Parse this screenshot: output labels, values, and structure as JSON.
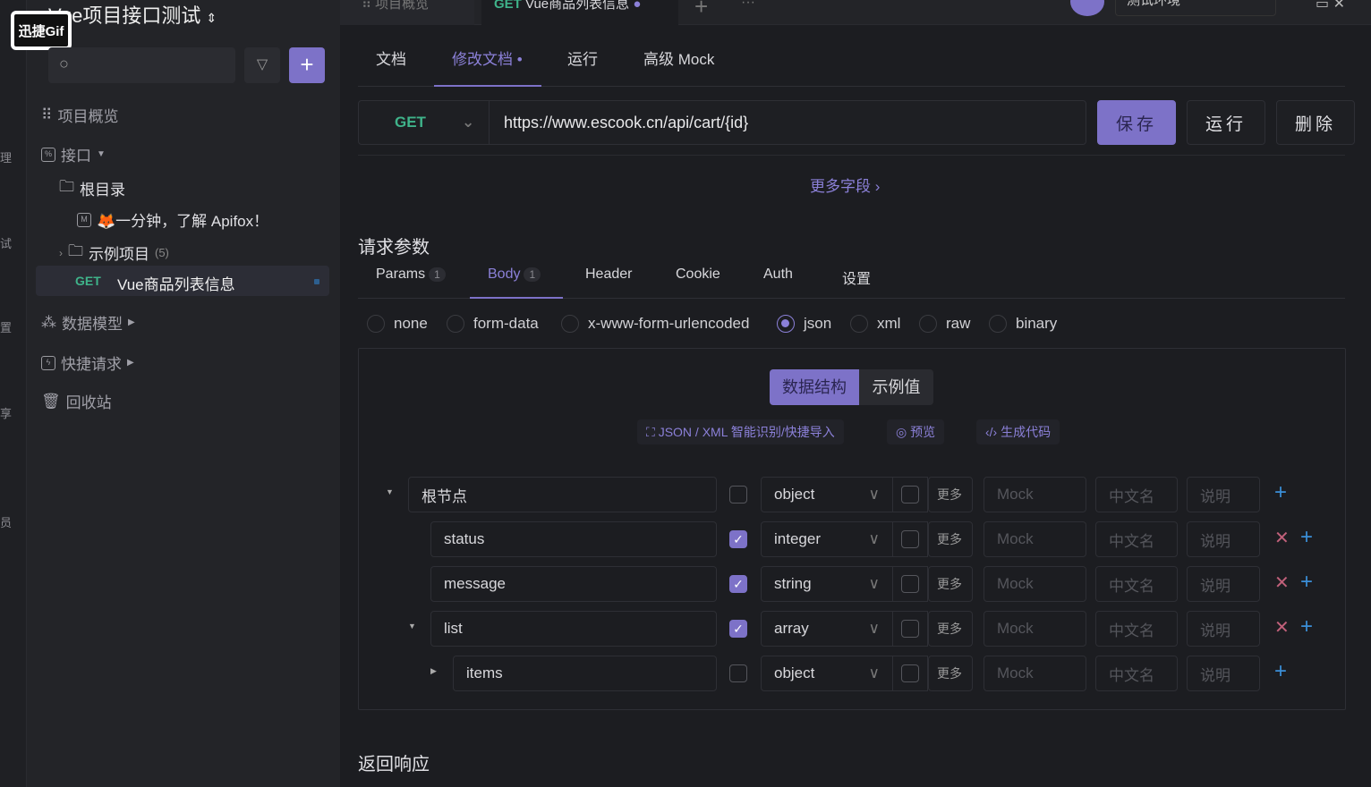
{
  "watermark": "迅捷Gif",
  "project": {
    "title": "Vue项目接口测试",
    "switch_icon": "⌃⌄"
  },
  "rail": [
    "理",
    "试",
    "置",
    "享",
    "员"
  ],
  "top_tabs": [
    {
      "label": "项目概览"
    },
    {
      "method": "GET",
      "label": "Vue商品列表信息"
    }
  ],
  "environment": "测试环境",
  "sidebar": {
    "items": [
      {
        "label": "项目概览"
      },
      {
        "label": "接口"
      },
      {
        "label": "根目录"
      },
      {
        "label": "🦊一分钟，了解 Apifox！"
      },
      {
        "label": "示例项目",
        "count": "(5)"
      },
      {
        "method": "GET",
        "label": "Vue商品列表信息"
      },
      {
        "label": "数据模型"
      },
      {
        "label": "快捷请求"
      },
      {
        "label": "回收站"
      }
    ]
  },
  "doc_tabs": [
    "文档",
    "修改文档",
    "运行",
    "高级 Mock"
  ],
  "request": {
    "method": "GET",
    "url": "https://www.escook.cn/api/cart/{id}",
    "save": "保存",
    "run": "运行",
    "delete": "删除",
    "more_fields": "更多字段"
  },
  "params_title": "请求参数",
  "param_tabs": [
    {
      "label": "Params",
      "count": "1"
    },
    {
      "label": "Body",
      "count": "1"
    },
    {
      "label": "Header"
    },
    {
      "label": "Cookie"
    },
    {
      "label": "Auth"
    },
    {
      "label": "设置"
    }
  ],
  "body_types": [
    "none",
    "form-data",
    "x-www-form-urlencoded",
    "json",
    "xml",
    "raw",
    "binary"
  ],
  "body_selected": "json",
  "mode": {
    "structure": "数据结构",
    "example": "示例值"
  },
  "tools": {
    "import": "JSON / XML 智能识别/快捷导入",
    "preview": "预览",
    "code": "生成代码"
  },
  "schema_placeholders": {
    "more": "更多",
    "mock": "Mock",
    "cn": "中文名",
    "desc": "说明"
  },
  "schema": [
    {
      "name": "根节点",
      "type": "object",
      "required": false
    },
    {
      "name": "status",
      "type": "integer",
      "required": true
    },
    {
      "name": "message",
      "type": "string",
      "required": true
    },
    {
      "name": "list",
      "type": "array",
      "required": true
    },
    {
      "name": "items",
      "type": "object",
      "required": false
    }
  ],
  "response_title": "返回响应",
  "colors": {
    "accent": "#7d72c8",
    "get": "#3fb38a"
  }
}
